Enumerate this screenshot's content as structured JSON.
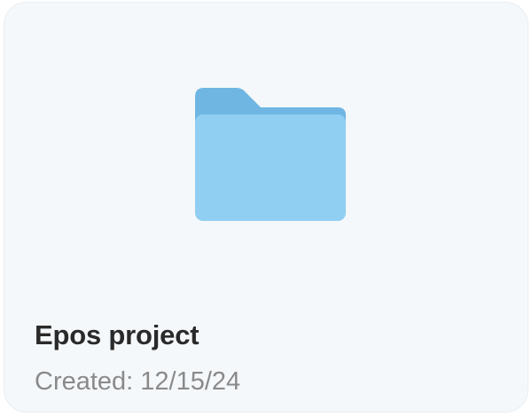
{
  "card": {
    "icon": "folder-icon",
    "title": "Epos project",
    "created_label": "Created:",
    "created_date": "12/15/24",
    "colors": {
      "background": "#f5f8fa",
      "folder_back": "#6fb6e3",
      "folder_front": "#90cff2",
      "title": "#2a2a2a",
      "meta": "#8a8a8a"
    }
  }
}
